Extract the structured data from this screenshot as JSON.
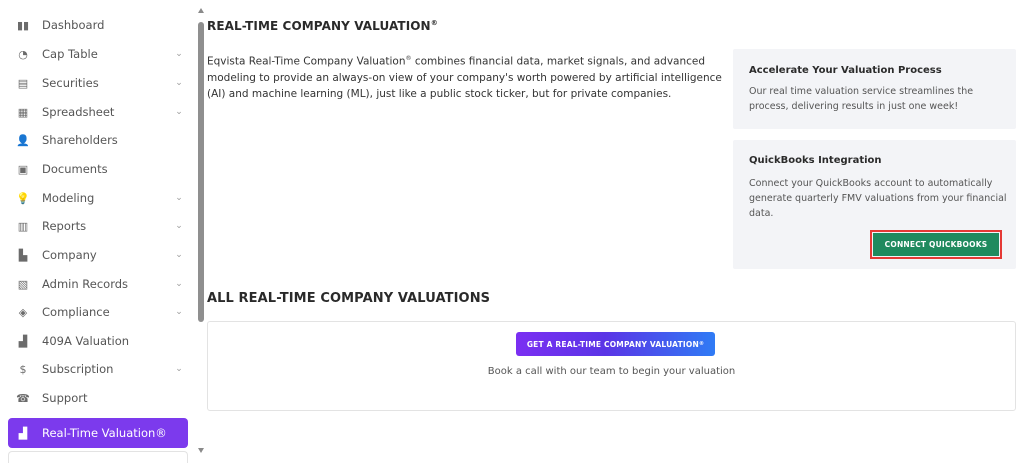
{
  "sidebar": {
    "items": [
      {
        "label": "Dashboard",
        "icon": "dashboard-icon",
        "glyph": "▮▮",
        "chevron": ""
      },
      {
        "label": "Cap Table",
        "icon": "pie-chart-icon",
        "glyph": "◔",
        "chevron": "⌄"
      },
      {
        "label": "Securities",
        "icon": "clipboard-icon",
        "glyph": "▤",
        "chevron": "⌄"
      },
      {
        "label": "Spreadsheet",
        "icon": "table-icon",
        "glyph": "▦",
        "chevron": "⌄"
      },
      {
        "label": "Shareholders",
        "icon": "user-icon",
        "glyph": "👤",
        "chevron": ""
      },
      {
        "label": "Documents",
        "icon": "folder-icon",
        "glyph": "▣",
        "chevron": ""
      },
      {
        "label": "Modeling",
        "icon": "lightbulb-icon",
        "glyph": "💡",
        "chevron": "⌄"
      },
      {
        "label": "Reports",
        "icon": "report-icon",
        "glyph": "▥",
        "chevron": "⌄"
      },
      {
        "label": "Company",
        "icon": "building-icon",
        "glyph": "▙",
        "chevron": "⌄"
      },
      {
        "label": "Admin Records",
        "icon": "records-icon",
        "glyph": "▧",
        "chevron": "⌄"
      },
      {
        "label": "Compliance",
        "icon": "shield-check-icon",
        "glyph": "◈",
        "chevron": "⌄"
      },
      {
        "label": "409A Valuation",
        "icon": "bar-chart-icon",
        "glyph": "▟",
        "chevron": ""
      },
      {
        "label": "Subscription",
        "icon": "dollar-icon",
        "glyph": "$",
        "chevron": "⌄"
      },
      {
        "label": "Support",
        "icon": "support-icon",
        "glyph": "☎",
        "chevron": ""
      },
      {
        "label": "Real-Time Valuation®",
        "icon": "valuation-chart-icon",
        "glyph": "▟",
        "chevron": ""
      }
    ],
    "active_index": 14,
    "active_color": "#7c3aed"
  },
  "header": {
    "title": "REAL-TIME COMPANY VALUATION",
    "title_mark": "®"
  },
  "intro": {
    "part1": "Eqvista Real-Time Company Valuation",
    "mark": "®",
    "part2": " combines financial data, market signals, and advanced modeling to provide an always-on view of your company's worth powered by artificial intelligence (AI) and machine learning (ML), just like a public stock ticker, but for private companies."
  },
  "card_accelerate": {
    "title": "Accelerate Your Valuation Process",
    "text": "Our real time valuation service streamlines the process, delivering results in just one week!"
  },
  "card_quickbooks": {
    "title": "QuickBooks Integration",
    "text": "Connect your QuickBooks account to automatically generate quarterly FMV valuations from your financial data.",
    "button_label": "CONNECT QUICKBOOKS",
    "button_color": "#1f8a5e"
  },
  "valuations": {
    "section_title": "ALL REAL-TIME COMPANY VALUATIONS",
    "button_label": "GET A REAL-TIME COMPANY VALUATION",
    "button_mark": "®",
    "book_text": "Book a call with our team to begin your valuation"
  }
}
